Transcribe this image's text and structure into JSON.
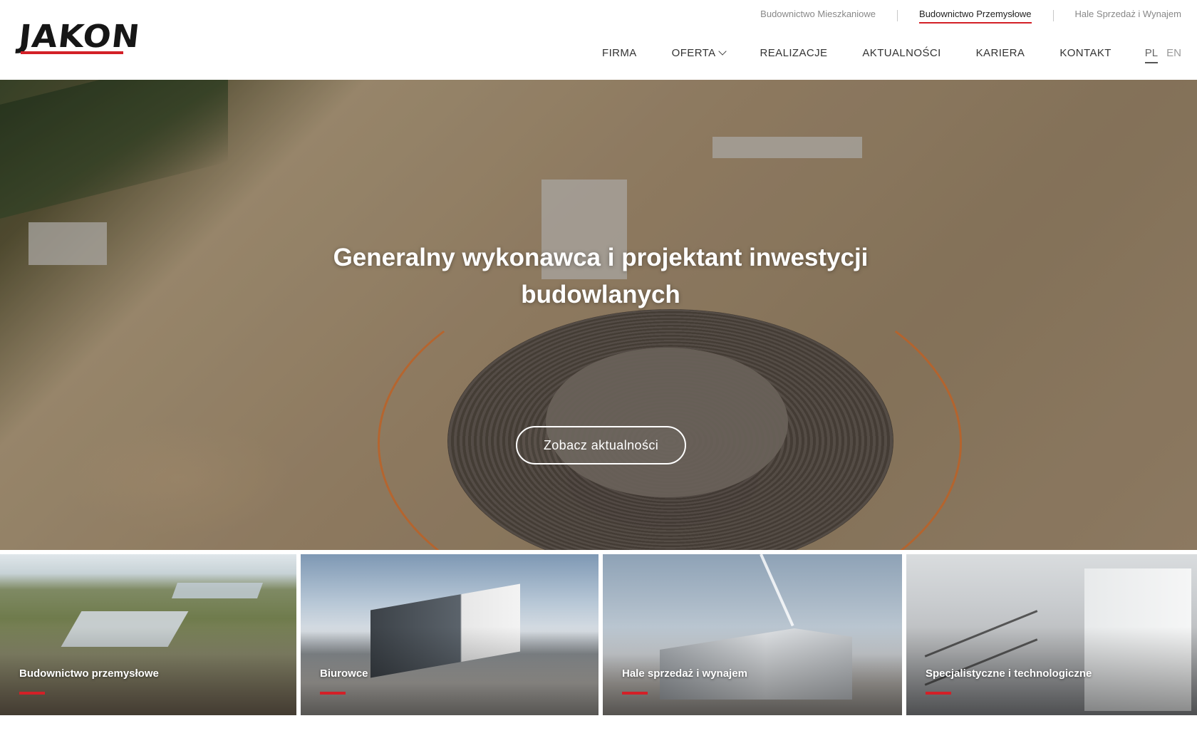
{
  "brand": {
    "logo_text": "JAKON",
    "accent_color": "#d32027"
  },
  "segments": {
    "items": [
      {
        "label": "Budownictwo Mieszkaniowe",
        "active": false
      },
      {
        "label": "Budownictwo Przemysłowe",
        "active": true
      },
      {
        "label": "Hale Sprzedaż i Wynajem",
        "active": false
      }
    ]
  },
  "nav": {
    "items": [
      {
        "label": "FIRMA"
      },
      {
        "label": "OFERTA",
        "icon": "chevron-down-icon"
      },
      {
        "label": "REALIZACJE"
      },
      {
        "label": "AKTUALNOŚCI"
      },
      {
        "label": "KARIERA"
      },
      {
        "label": "KONTAKT"
      }
    ]
  },
  "langs": {
    "items": [
      {
        "label": "PL",
        "active": true
      },
      {
        "label": "EN",
        "active": false
      }
    ]
  },
  "hero": {
    "title": "Generalny wykonawca i projektant inwestycji budowlanych",
    "button_label": "Zobacz aktualności"
  },
  "tiles": {
    "items": [
      {
        "label": "Budownictwo przemysłowe"
      },
      {
        "label": "Biurowce"
      },
      {
        "label": "Hale sprzedaż i wynajem"
      },
      {
        "label": "Specjalistyczne i technologiczne"
      }
    ]
  }
}
